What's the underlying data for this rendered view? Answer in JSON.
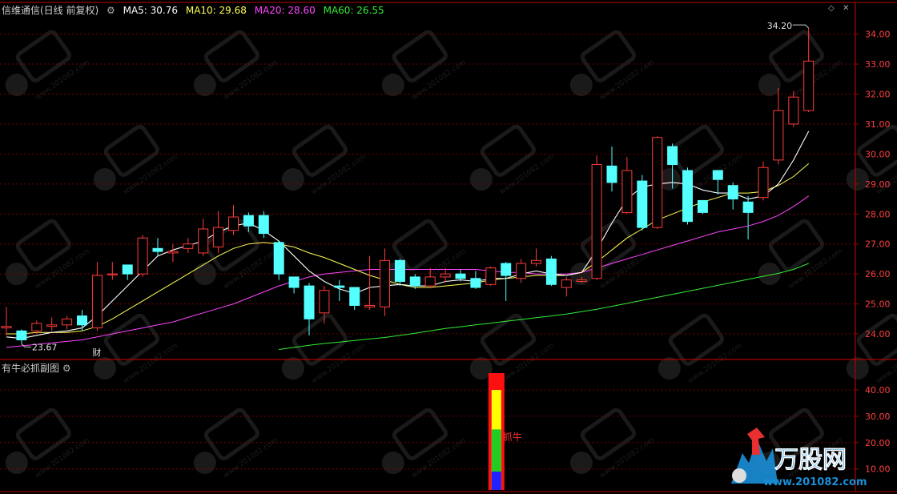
{
  "header": {
    "title": "信维通信(日线 前复权)",
    "ma": [
      {
        "label": "MA5: 30.76",
        "color": "#ffffff"
      },
      {
        "label": "MA10: 29.68",
        "color": "#ffff55"
      },
      {
        "label": "MA20: 28.60",
        "color": "#ff44ff"
      },
      {
        "label": "MA60: 26.55",
        "color": "#33ee33"
      }
    ]
  },
  "sub_header": {
    "title": "有牛必抓副图"
  },
  "controls": {
    "diamond_icon": "diamond-icon",
    "close_icon": "close-icon"
  },
  "watermark": {
    "brand": "万股网",
    "url": "www.201082.com"
  },
  "chart_data": [
    {
      "type": "candlestick",
      "ylim": [
        23.2,
        34.55
      ],
      "y_ticks": [
        "24.00",
        "25.00",
        "26.00",
        "27.00",
        "28.00",
        "29.00",
        "30.00",
        "31.00",
        "32.00",
        "33.00",
        "34.00"
      ],
      "annotations": {
        "max_label": "34.20",
        "min_label": "23.67",
        "fin_marker": "财"
      },
      "colors": {
        "up": "#ff3b3b",
        "down": "#54ffff",
        "grid": "#7a0000",
        "axis": "#b30000"
      },
      "candles": [
        [
          24.2,
          24.25,
          24.9,
          23.95
        ],
        [
          24.1,
          23.8,
          24.15,
          23.67
        ],
        [
          24.1,
          24.35,
          24.45,
          24.0
        ],
        [
          24.25,
          24.3,
          24.55,
          24.1
        ],
        [
          24.3,
          24.5,
          24.6,
          24.15
        ],
        [
          24.6,
          24.3,
          24.8,
          24.1
        ],
        [
          24.2,
          25.95,
          26.4,
          24.1
        ],
        [
          26.0,
          26.0,
          26.4,
          25.8
        ],
        [
          26.3,
          26.0,
          26.3,
          25.8
        ],
        [
          26.0,
          27.2,
          27.3,
          25.9
        ],
        [
          26.85,
          26.75,
          27.2,
          26.6
        ],
        [
          26.7,
          26.75,
          27.0,
          26.4
        ],
        [
          26.85,
          27.0,
          27.2,
          26.7
        ],
        [
          26.7,
          27.5,
          27.85,
          26.6
        ],
        [
          26.9,
          27.55,
          28.1,
          26.7
        ],
        [
          27.45,
          27.9,
          28.3,
          27.3
        ],
        [
          27.95,
          27.6,
          28.05,
          27.4
        ],
        [
          27.95,
          27.35,
          28.1,
          27.2
        ],
        [
          27.05,
          26.0,
          27.1,
          25.8
        ],
        [
          25.9,
          25.55,
          25.9,
          25.35
        ],
        [
          25.6,
          24.5,
          25.7,
          23.95
        ],
        [
          24.7,
          25.45,
          25.6,
          24.35
        ],
        [
          25.6,
          25.55,
          25.8,
          25.1
        ],
        [
          25.55,
          24.95,
          25.55,
          24.8
        ],
        [
          24.9,
          24.95,
          26.6,
          24.8
        ],
        [
          24.9,
          26.45,
          26.85,
          24.6
        ],
        [
          26.45,
          25.75,
          26.5,
          25.6
        ],
        [
          25.9,
          25.6,
          26.0,
          25.5
        ],
        [
          25.6,
          25.9,
          26.2,
          25.55
        ],
        [
          25.9,
          26.0,
          26.2,
          25.7
        ],
        [
          26.0,
          25.85,
          26.15,
          25.75
        ],
        [
          25.85,
          25.55,
          26.1,
          25.5
        ],
        [
          25.65,
          26.2,
          26.25,
          25.6
        ],
        [
          26.35,
          25.95,
          26.4,
          25.1
        ],
        [
          25.85,
          26.35,
          26.5,
          25.7
        ],
        [
          26.35,
          26.45,
          26.85,
          26.25
        ],
        [
          26.5,
          25.65,
          26.6,
          25.6
        ],
        [
          25.55,
          25.8,
          25.9,
          25.25
        ],
        [
          25.75,
          25.8,
          25.9,
          25.7
        ],
        [
          25.85,
          29.65,
          29.95,
          25.8
        ],
        [
          29.6,
          29.05,
          30.25,
          28.75
        ],
        [
          28.05,
          29.45,
          29.9,
          28.0
        ],
        [
          29.1,
          27.55,
          29.3,
          27.45
        ],
        [
          27.55,
          30.55,
          30.6,
          27.5
        ],
        [
          30.25,
          29.65,
          30.35,
          28.85
        ],
        [
          29.45,
          27.75,
          29.55,
          27.65
        ],
        [
          28.45,
          28.05,
          28.45,
          28.0
        ],
        [
          29.45,
          29.15,
          29.45,
          28.65
        ],
        [
          28.95,
          28.5,
          29.05,
          28.15
        ],
        [
          28.4,
          28.05,
          28.6,
          27.15
        ],
        [
          28.55,
          29.55,
          29.75,
          28.45
        ],
        [
          29.8,
          31.45,
          32.2,
          29.65
        ],
        [
          31.0,
          31.9,
          32.1,
          30.9
        ],
        [
          31.45,
          33.1,
          34.2,
          31.4
        ]
      ],
      "ma": {
        "MA5": [
          23.9,
          23.85,
          23.95,
          24.05,
          24.1,
          24.2,
          24.6,
          25.1,
          25.6,
          26.1,
          26.6,
          26.8,
          26.95,
          27.1,
          27.4,
          27.6,
          27.7,
          27.45,
          27.1,
          26.6,
          26.1,
          25.75,
          25.5,
          25.35,
          25.55,
          25.6,
          25.65,
          25.6,
          25.6,
          25.75,
          25.8,
          25.75,
          25.85,
          25.85,
          26.0,
          26.1,
          26.0,
          25.95,
          26.05,
          26.8,
          27.7,
          28.5,
          28.9,
          29.0,
          29.05,
          29.0,
          28.8,
          28.7,
          28.7,
          28.5,
          28.6,
          29.0,
          29.8,
          30.76
        ],
        "MA10": [
          24.0,
          24.0,
          24.05,
          24.05,
          24.05,
          24.1,
          24.25,
          24.5,
          24.8,
          25.1,
          25.4,
          25.7,
          26.0,
          26.3,
          26.6,
          26.85,
          27.0,
          27.05,
          27.0,
          26.9,
          26.7,
          26.55,
          26.35,
          26.15,
          25.95,
          25.8,
          25.65,
          25.55,
          25.55,
          25.6,
          25.65,
          25.7,
          25.8,
          25.85,
          25.9,
          25.95,
          25.95,
          25.95,
          26.05,
          26.4,
          26.8,
          27.2,
          27.5,
          27.8,
          28.0,
          28.2,
          28.4,
          28.55,
          28.7,
          28.7,
          28.75,
          28.95,
          29.25,
          29.68
        ],
        "MA20": [
          23.55,
          23.6,
          23.65,
          23.7,
          23.75,
          23.8,
          23.9,
          24.0,
          24.1,
          24.2,
          24.3,
          24.4,
          24.55,
          24.7,
          24.85,
          25.0,
          25.2,
          25.4,
          25.6,
          25.75,
          25.9,
          26.0,
          26.05,
          26.1,
          26.15,
          26.15,
          26.15,
          26.15,
          26.15,
          26.15,
          26.15,
          26.15,
          26.1,
          26.05,
          26.05,
          26.0,
          26.0,
          26.0,
          26.05,
          26.2,
          26.35,
          26.5,
          26.65,
          26.8,
          26.95,
          27.1,
          27.25,
          27.4,
          27.5,
          27.6,
          27.75,
          27.95,
          28.25,
          28.6
        ],
        "MA60_start_index": 18,
        "MA60": [
          23.48,
          23.55,
          23.62,
          23.68,
          23.73,
          23.78,
          23.83,
          23.88,
          23.95,
          24.02,
          24.1,
          24.18,
          24.24,
          24.3,
          24.36,
          24.42,
          24.48,
          24.54,
          24.6,
          24.66,
          24.74,
          24.82,
          24.92,
          25.02,
          25.12,
          25.22,
          25.32,
          25.42,
          25.52,
          25.62,
          25.72,
          25.82,
          25.92,
          26.02,
          26.15,
          26.35
        ]
      }
    },
    {
      "type": "bar",
      "title": "有牛必抓副图",
      "ylim": [
        2,
        47
      ],
      "y_ticks": [
        "10.00",
        "20.00",
        "30.00",
        "40.00"
      ],
      "signal": {
        "label": "抓牛",
        "index": 32,
        "stack": [
          {
            "from": 2,
            "to": 48,
            "color": "#ff1010"
          },
          {
            "from": 2,
            "to": 40,
            "color": "#ffff00"
          },
          {
            "from": 2,
            "to": 25,
            "color": "#22cc22"
          },
          {
            "from": 2,
            "to": 9,
            "color": "#2222ff"
          }
        ]
      }
    }
  ]
}
